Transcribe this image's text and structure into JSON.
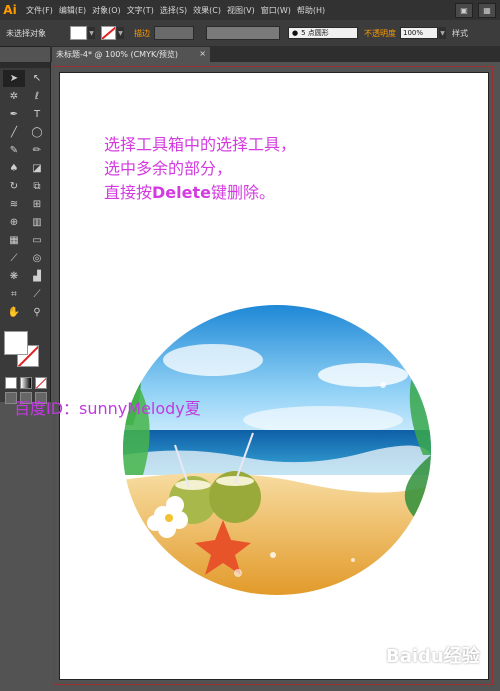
{
  "app": {
    "logo": "Ai"
  },
  "menu": {
    "items": [
      "文件(F)",
      "编辑(E)",
      "对象(O)",
      "文字(T)",
      "选择(S)",
      "效果(C)",
      "视图(V)",
      "窗口(W)",
      "帮助(H)"
    ]
  },
  "control_bar": {
    "selection_status": "未选择对象",
    "stroke_label": "描边",
    "brush_value": "5 点圆形",
    "opacity_label": "不透明度",
    "opacity_value": "100%",
    "style_label": "样式"
  },
  "document_tab": {
    "title": "未标题-4* @ 100% (CMYK/预览)",
    "close": "×"
  },
  "canvas": {
    "instruction_lines": [
      "选择工具箱中的选择工具，",
      "选中多余的部分，",
      "直接按"
    ],
    "instruction_key": "Delete",
    "instruction_tail": "键删除。",
    "watermark": "百度ID：sunnyMelody夏",
    "brand_watermark": "Baidu经验"
  },
  "colors": {
    "accent_orange": "#ff9a00",
    "instruction_text": "#d33be0",
    "stroke_none": "#e02020"
  },
  "icons": [
    "selection-tool-icon",
    "direct-selection-tool-icon",
    "magic-wand-icon",
    "lasso-icon",
    "pen-tool-icon",
    "type-tool-icon",
    "line-tool-icon",
    "ellipse-tool-icon",
    "paintbrush-icon",
    "pencil-icon",
    "blob-brush-icon",
    "eraser-icon",
    "rotate-icon",
    "scale-icon",
    "width-tool-icon",
    "free-transform-icon",
    "shape-builder-icon",
    "perspective-grid-icon",
    "mesh-icon",
    "gradient-icon",
    "eyedropper-icon",
    "blend-icon",
    "symbol-sprayer-icon",
    "graph-icon",
    "artboard-tool-icon",
    "slice-icon",
    "hand-icon",
    "zoom-icon"
  ]
}
